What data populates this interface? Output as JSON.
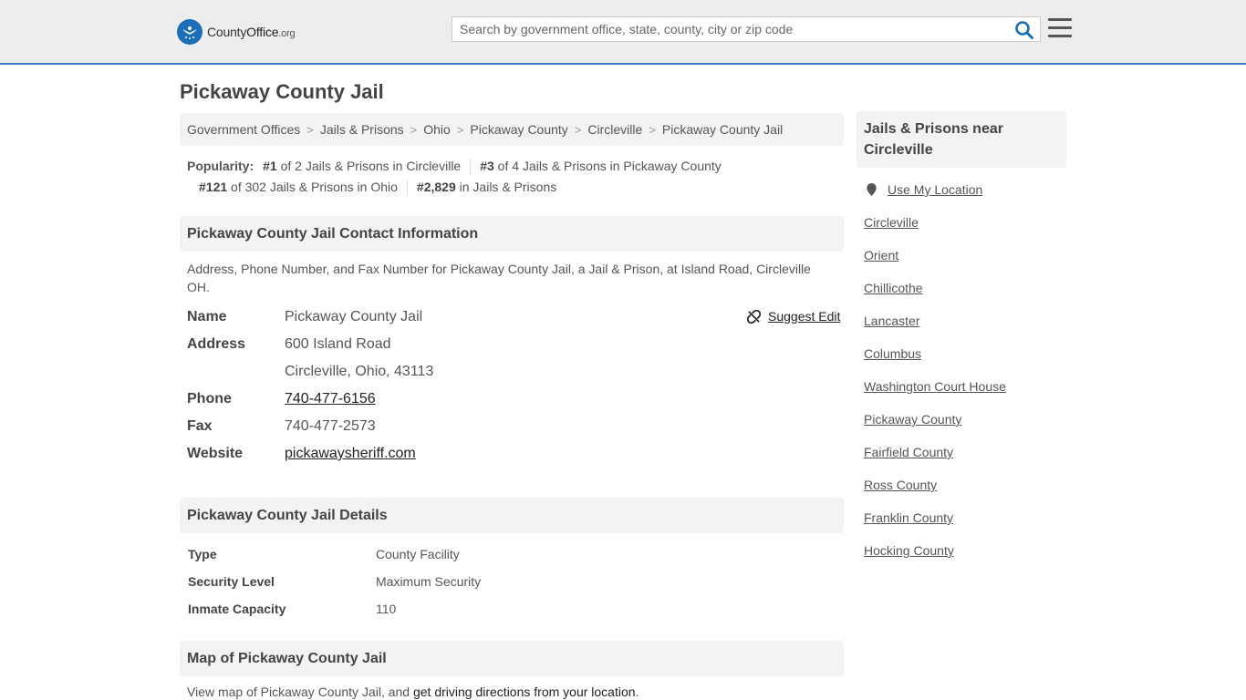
{
  "header": {
    "logo_main": "County",
    "logo_bold": "Office",
    "logo_org": ".org",
    "search_placeholder": "Search by government office, state, county, city or zip code",
    "brand_color": "#1d6fb5",
    "accent_color": "#3a7fc1"
  },
  "page": {
    "title": "Pickaway County Jail"
  },
  "breadcrumb": [
    "Government Offices",
    "Jails & Prisons",
    "Ohio",
    "Pickaway County",
    "Circleville",
    "Pickaway County Jail"
  ],
  "popularity": {
    "label": "Popularity:",
    "items": [
      {
        "rank": "#1",
        "text": " of 2 Jails & Prisons in Circleville"
      },
      {
        "rank": "#3",
        "text": " of 4 Jails & Prisons in Pickaway County"
      },
      {
        "rank": "#121",
        "text": " of 302 Jails & Prisons in Ohio"
      },
      {
        "rank": "#2,829",
        "text": " in Jails & Prisons"
      }
    ]
  },
  "contact": {
    "heading": "Pickaway County Jail Contact Information",
    "description": "Address, Phone Number, and Fax Number for Pickaway County Jail, a Jail & Prison, at Island Road, Circleville OH.",
    "suggest_edit": "Suggest Edit",
    "name_label": "Name",
    "name": "Pickaway County Jail",
    "address_label": "Address",
    "address_line1": "600 Island Road",
    "address_line2": "Circleville, Ohio, 43113",
    "phone_label": "Phone",
    "phone": "740-477-6156",
    "fax_label": "Fax",
    "fax": "740-477-2573",
    "website_label": "Website",
    "website": "pickawaysheriff.com"
  },
  "details": {
    "heading": "Pickaway County Jail Details",
    "rows": [
      {
        "label": "Type",
        "value": "County Facility"
      },
      {
        "label": "Security Level",
        "value": "Maximum Security"
      },
      {
        "label": "Inmate Capacity",
        "value": "110"
      }
    ]
  },
  "map": {
    "heading": "Map of Pickaway County Jail",
    "text_before": "View map of Pickaway County Jail, and ",
    "link": "get driving directions from your location",
    "text_after": "."
  },
  "sidebar": {
    "heading": "Jails & Prisons near Circleville",
    "use_location": "Use My Location",
    "links": [
      "Circleville",
      "Orient",
      "Chillicothe",
      "Lancaster",
      "Columbus",
      "Washington Court House",
      "Pickaway County",
      "Fairfield County",
      "Ross County",
      "Franklin County",
      "Hocking County"
    ]
  }
}
